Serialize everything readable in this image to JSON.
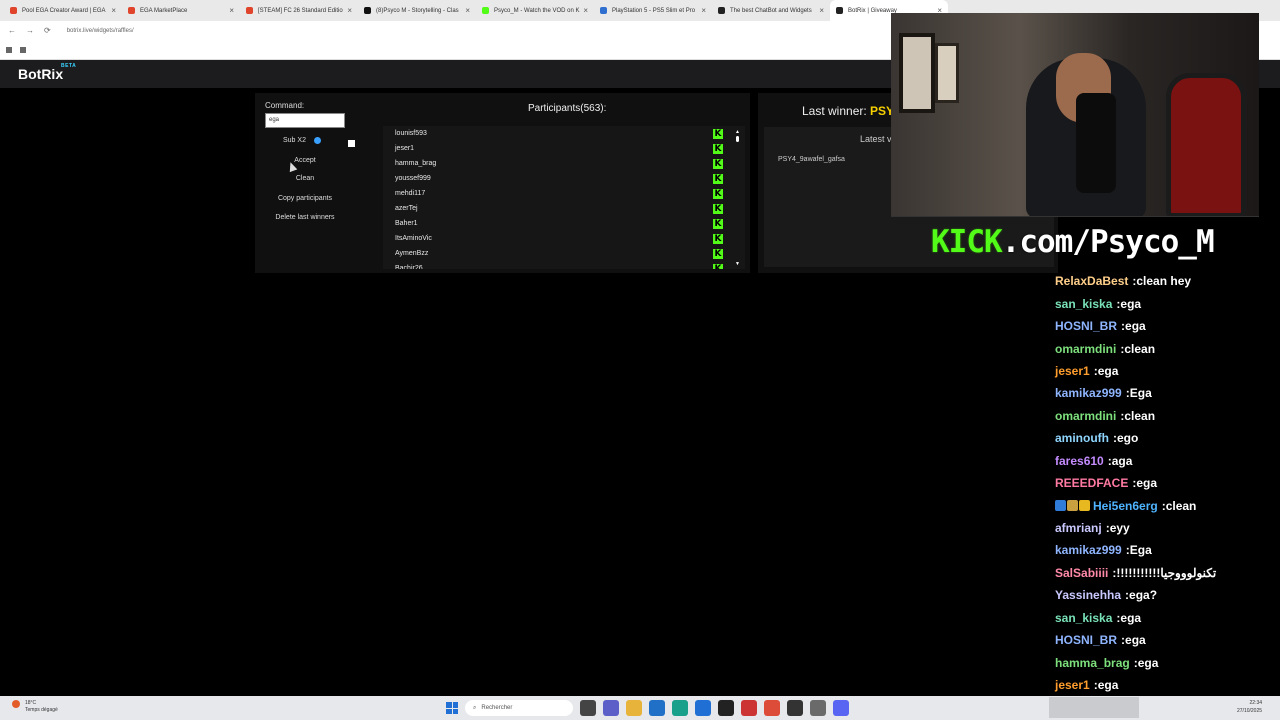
{
  "browser": {
    "tabs": [
      {
        "title": "Pool EGA Creator Award | EGA",
        "color": "#e0452b"
      },
      {
        "title": "EGA MarketPlace",
        "color": "#e0452b"
      },
      {
        "title": "[STEAM] FC 26 Standard Editio",
        "color": "#e0452b"
      },
      {
        "title": "(8)Psyco M - Storytelling - Clas",
        "color": "#111111"
      },
      {
        "title": "Psyco_M - Watch the VOD on K",
        "color": "#53fc18"
      },
      {
        "title": "PlayStation 5 - PS5 Slim et Pro",
        "color": "#2f6fd0"
      },
      {
        "title": "The best ChatBot and Widgets",
        "color": "#222222"
      },
      {
        "title": "BotRix | Giveaway",
        "color": "#222222",
        "active": true
      }
    ],
    "url": "botrix.live/widgets/raffles/"
  },
  "app": {
    "logo": "BotRix",
    "logo_badge": "BETA"
  },
  "raffle": {
    "command_label": "Command:",
    "command_value": "ega",
    "sub_label": "Sub X2",
    "accept_label": "Accept",
    "clean_label": "Clean",
    "copy_label": "Copy participants",
    "delete_label": "Delete last winners",
    "participants_title": "Participants(563):",
    "participants": [
      "lounisf593",
      "jeser1",
      "hamma_brag",
      "youssef999",
      "mehdi117",
      "azerTej",
      "Baher1",
      "ItsAminoVic",
      "AymenBzz",
      "Bachir26"
    ],
    "platform_icon": "K"
  },
  "winner": {
    "last_winner_label": "Last winner:",
    "last_winner_name": "PSY",
    "latest_title": "Latest v",
    "latest_entry": "PSY4_9awafel_gafsa"
  },
  "overlay": {
    "banner_green": "KICK",
    "banner_white": ".com/Psyco_M"
  },
  "chat": [
    {
      "user": "RelaxDaBest",
      "color": "#ffcf8a",
      "msg": "clean hey"
    },
    {
      "user": "san_kiska",
      "color": "#79e3b8",
      "msg": "ega"
    },
    {
      "user": "HOSNI_BR",
      "color": "#8fb5ff",
      "msg": "ega"
    },
    {
      "user": "omarmdini",
      "color": "#7de07d",
      "msg": "clean"
    },
    {
      "user": "jeser1",
      "color": "#ff9d2e",
      "msg": "ega"
    },
    {
      "user": "kamikaz999",
      "color": "#8fb5ff",
      "msg": "Ega"
    },
    {
      "user": "omarmdini",
      "color": "#7de07d",
      "msg": "clean"
    },
    {
      "user": "aminoufh",
      "color": "#8fd6ff",
      "msg": "ego"
    },
    {
      "user": "fares610",
      "color": "#c48cff",
      "msg": "aga"
    },
    {
      "user": "REEEDFACE",
      "color": "#ff7aa2",
      "msg": "ega"
    },
    {
      "user": "Hei5en6erg",
      "color": "#4fb3ff",
      "msg": "clean",
      "badges": [
        "#2f7dd8",
        "#c8a040",
        "#e8b820"
      ]
    },
    {
      "user": "afmrianj",
      "color": "#c9c9ff",
      "msg": "eyy"
    },
    {
      "user": "kamikaz999",
      "color": "#8fb5ff",
      "msg": "Ega"
    },
    {
      "user": "SalSabiiii",
      "color": "#ff8aa8",
      "msg": "!!!!!!!!!!!تكنولوووجيا"
    },
    {
      "user": "Yassinehha",
      "color": "#c9c9ff",
      "msg": "ega?"
    },
    {
      "user": "san_kiska",
      "color": "#79e3b8",
      "msg": "ega"
    },
    {
      "user": "HOSNI_BR",
      "color": "#8fb5ff",
      "msg": "ega"
    },
    {
      "user": "hamma_brag",
      "color": "#7de07d",
      "msg": "ega"
    },
    {
      "user": "jeser1",
      "color": "#ff9d2e",
      "msg": "ega"
    }
  ],
  "taskbar": {
    "weather_temp": "18°C",
    "weather_desc": "Temps dégagé",
    "search_placeholder": "Rechercher",
    "time": "22:34",
    "date": "27/10/2025",
    "icons": [
      {
        "name": "task-view-icon",
        "color": "#444444"
      },
      {
        "name": "teams-icon",
        "color": "#5b5fc7"
      },
      {
        "name": "file-explorer-icon",
        "color": "#e8b33b"
      },
      {
        "name": "store-icon",
        "color": "#2170c8"
      },
      {
        "name": "edge-icon",
        "color": "#19a08a"
      },
      {
        "name": "outlook-icon",
        "color": "#1f6fd4"
      },
      {
        "name": "media-icon",
        "color": "#222222"
      },
      {
        "name": "app-icon",
        "color": "#cc3333"
      },
      {
        "name": "chrome-icon",
        "color": "#dd4b39"
      },
      {
        "name": "dark-app-icon",
        "color": "#333333"
      },
      {
        "name": "settings-icon",
        "color": "#6a6a6a"
      },
      {
        "name": "discord-icon",
        "color": "#5865f2"
      }
    ]
  }
}
